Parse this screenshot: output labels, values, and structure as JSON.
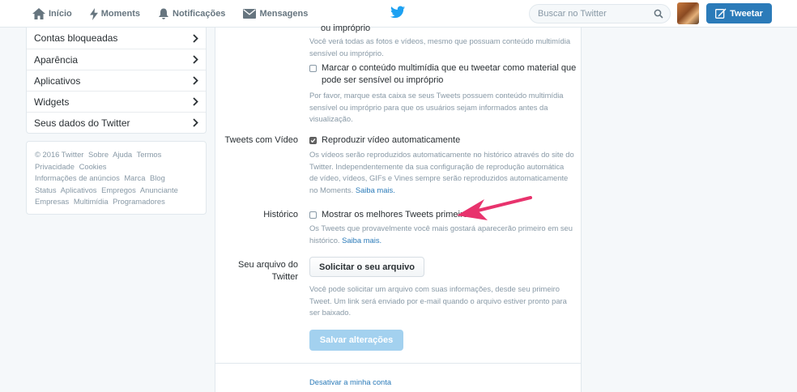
{
  "nav": {
    "home": "Início",
    "moments": "Moments",
    "notifications": "Notificações",
    "messages": "Mensagens"
  },
  "search": {
    "placeholder": "Buscar no Twitter"
  },
  "tweet_button": "Tweetar",
  "sidebar": {
    "items": [
      {
        "label": "Contas bloqueadas"
      },
      {
        "label": "Aparência"
      },
      {
        "label": "Aplicativos"
      },
      {
        "label": "Widgets"
      },
      {
        "label": "Seus dados do Twitter"
      }
    ],
    "footer": {
      "lines": [
        [
          "© 2016 Twitter",
          "Sobre",
          "Ajuda",
          "Termos"
        ],
        [
          "Privacidade",
          "Cookies"
        ],
        [
          "Informações de anúncios",
          "Marca",
          "Blog"
        ],
        [
          "Status",
          "Aplicativos",
          "Empregos",
          "Anunciante"
        ],
        [
          "Empresas",
          "Multimídia",
          "Programadores"
        ]
      ]
    }
  },
  "content": {
    "top_partial": "ou impróprio",
    "top_desc": [
      "Você verá todas as fotos e vídeos, mesmo que possuam conteúdo multimídia",
      "sensível ou impróprio."
    ],
    "mark_media": {
      "label_lines": [
        "Marcar o conteúdo multimídia que eu tweetar como material que",
        "pode ser sensível ou impróprio"
      ],
      "checked": false,
      "desc": [
        "Por favor, marque esta caixa se seus Tweets possuem conteúdo multimídia",
        "sensível ou impróprio para que os usuários sejam informados antes da",
        "visualização."
      ]
    },
    "video": {
      "label": "Tweets com Vídeo",
      "option": "Reproduzir vídeo automaticamente",
      "checked": true,
      "desc": [
        "Os vídeos serão reproduzidos automaticamente no histórico através do site do",
        "Twitter. Independentemente da sua configuração de reprodução automática",
        "de vídeo, vídeos, GIFs e Vines sempre serão reproduzidos automaticamente",
        "no Moments."
      ],
      "link": "Saiba mais."
    },
    "timeline": {
      "label": "Histórico",
      "option": "Mostrar os melhores Tweets primeiro",
      "checked": false,
      "desc": [
        "Os Tweets que provavelmente você mais gostará aparecerão primeiro em seu",
        "histórico."
      ],
      "link": "Saiba mais."
    },
    "archive": {
      "label_lines": [
        "Seu arquivo do",
        "Twitter"
      ],
      "button": "Solicitar o seu arquivo",
      "desc": [
        "Você pode solicitar um arquivo com suas informações, desde seu primeiro",
        "Tweet. Um link será enviado por e-mail quando o arquivo estiver pronto para",
        "ser baixado."
      ]
    },
    "save_button": "Salvar alterações",
    "deactivate": "Desativar a minha conta"
  },
  "colors": {
    "brand": "#1da1f2",
    "link": "#2b7bb9",
    "annotation_arrow": "#e8336d"
  }
}
